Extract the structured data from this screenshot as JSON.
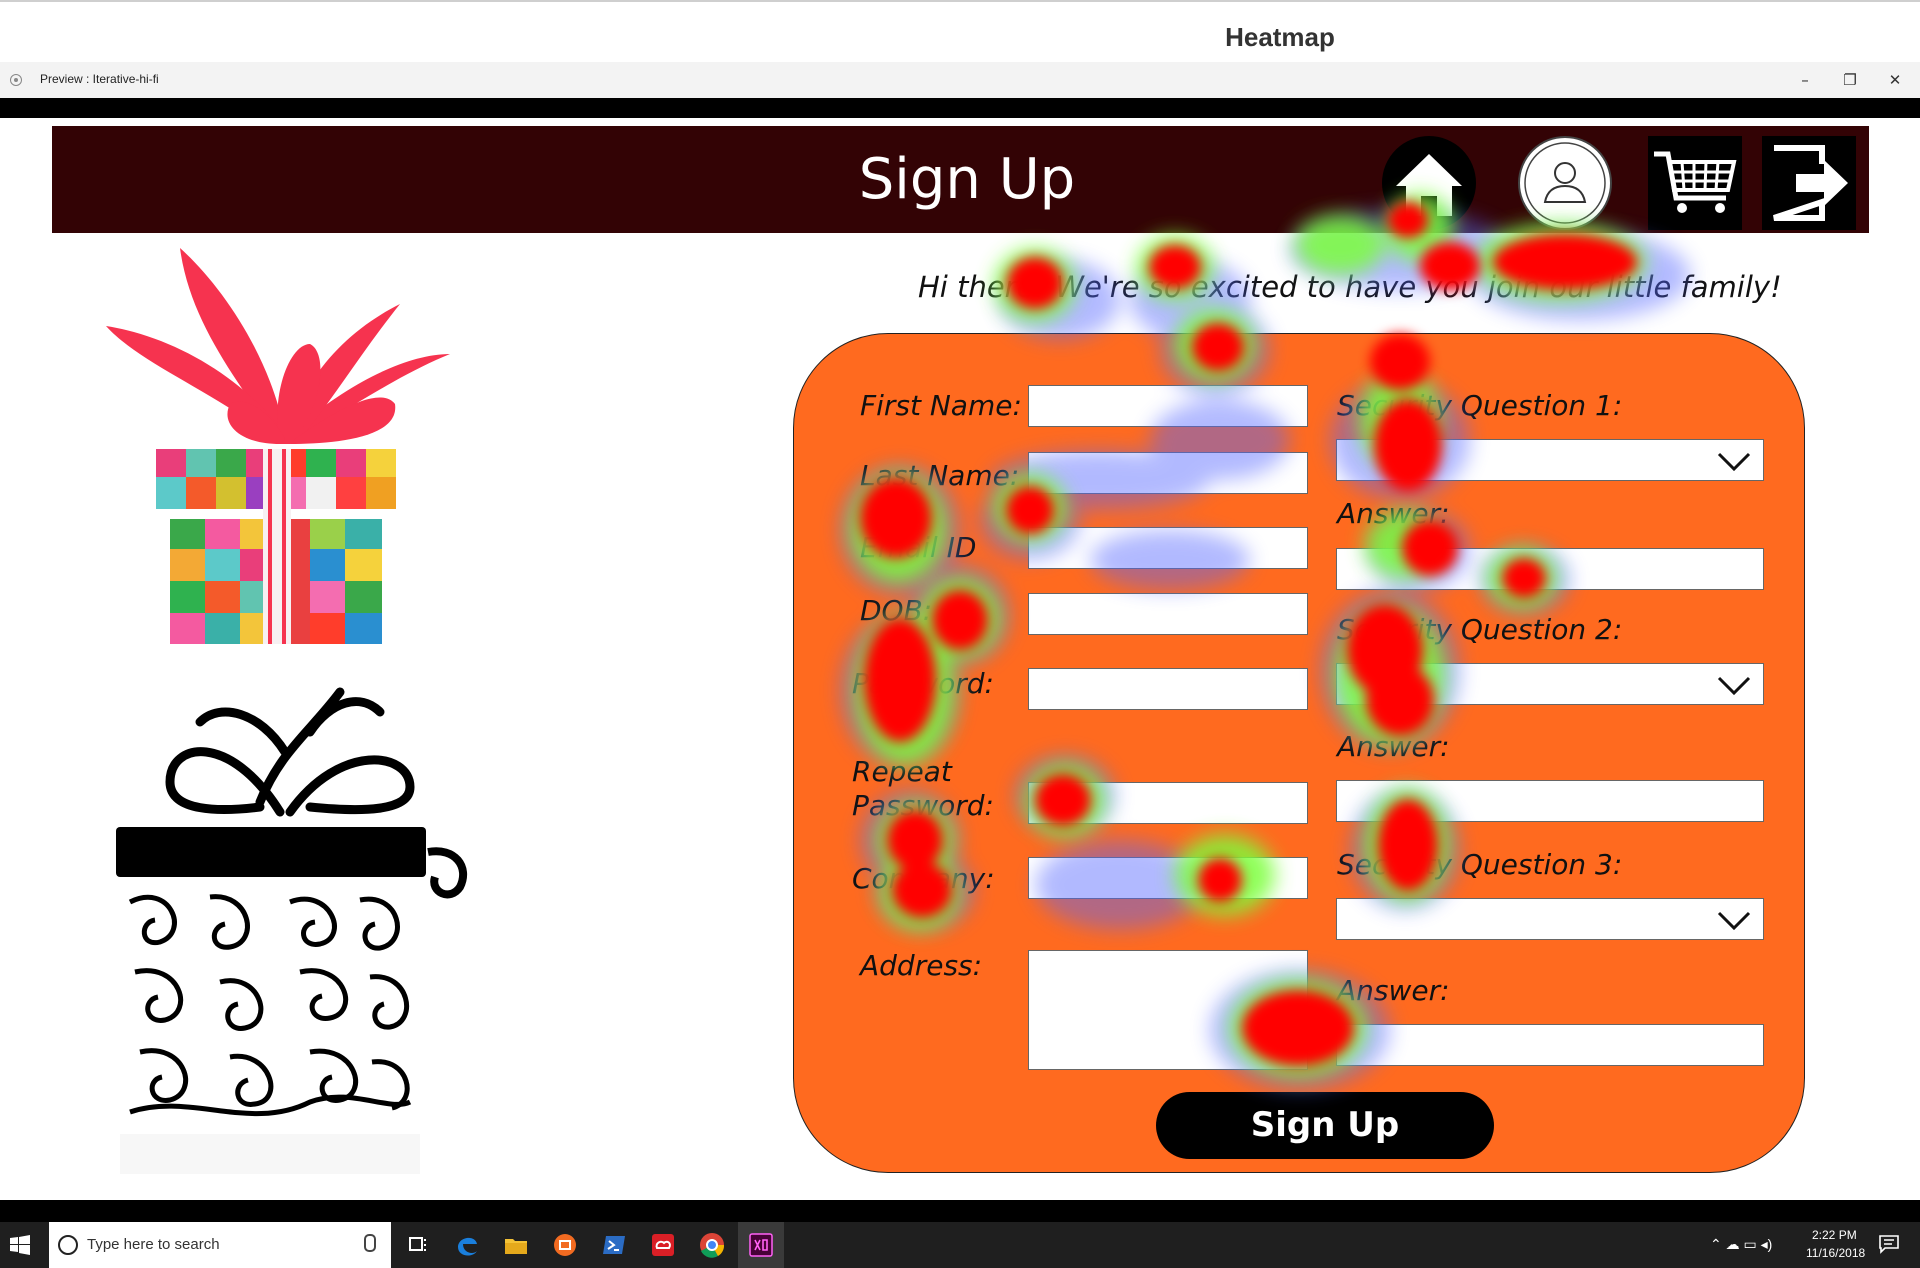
{
  "top": {
    "title": "Heatmap"
  },
  "window": {
    "title": "Preview : Iterative-hi-fi",
    "minimize": "–",
    "restore": "❐",
    "close": "✕"
  },
  "header": {
    "title": "Sign Up",
    "icons": [
      "home-icon",
      "profile-icon",
      "cart-icon",
      "logout-icon"
    ]
  },
  "greeting": "Hi there! We're so excited to have you join our little family!",
  "form": {
    "left_fields": [
      {
        "label": "First Name:"
      },
      {
        "label": "Last Name:"
      },
      {
        "label": "Email ID"
      },
      {
        "label": "DOB:"
      },
      {
        "label": "Password:"
      },
      {
        "label": "Repeat Password:"
      },
      {
        "label": "Company:"
      },
      {
        "label": "Address:"
      }
    ],
    "right_fields": {
      "sq1": "Security Question 1:",
      "sq2": "Security Question 2:",
      "sq3": "Security Question 3:",
      "answer": "Answer:"
    },
    "submit_label": "Sign Up"
  },
  "colors": {
    "header": "#330305",
    "panel": "#ff6a1f",
    "heat_hot": "#ff0000",
    "heat_warm": "#7cff3a",
    "heat_cool": "#4a5cff"
  },
  "taskbar": {
    "search_placeholder": "Type here to search",
    "apps": [
      "windows-start-icon",
      "task-view-icon",
      "edge-icon",
      "file-explorer-icon",
      "app-icon",
      "powershell-icon",
      "creative-cloud-icon",
      "chrome-icon",
      "adobe-xd-icon"
    ],
    "time": "2:22 PM",
    "date": "11/16/2018"
  }
}
